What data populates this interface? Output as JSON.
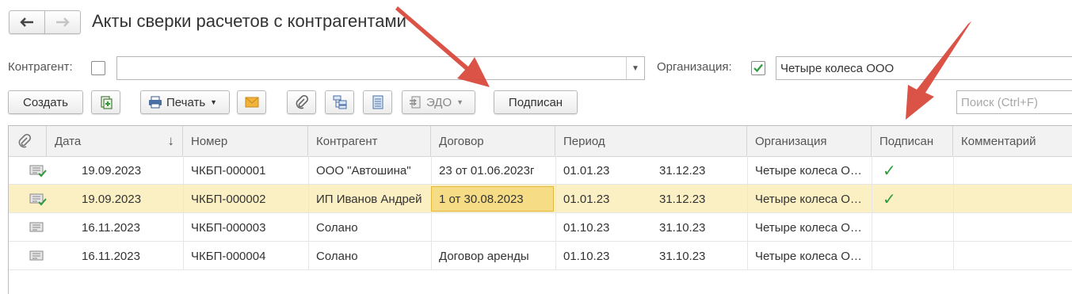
{
  "window": {
    "title": "Акты сверки расчетов с контрагентами"
  },
  "nav": {
    "back": "back-arrow-icon",
    "forward": "forward-arrow-icon"
  },
  "filters": {
    "counterparty_label": "Контрагент:",
    "counterparty_checked": false,
    "counterparty_value": "",
    "organization_label": "Организация:",
    "organization_checked": true,
    "organization_value": "Четыре колеса ООО"
  },
  "toolbar": {
    "create_label": "Создать",
    "print_label": "Печать",
    "edo_label": "ЭДО",
    "signed_label": "Подписан",
    "search_placeholder": "Поиск (Ctrl+F)"
  },
  "table": {
    "columns": [
      "",
      "Дата",
      "Номер",
      "Контрагент",
      "Договор",
      "Период",
      "",
      "Организация",
      "Подписан",
      "Комментарий"
    ],
    "sort_indicator": "↓",
    "rows": [
      {
        "icon": "document-signed-icon",
        "date": "19.09.2023",
        "number": "ЧКБП-000001",
        "counterparty": "ООО \"Автошина\"",
        "contract": "23 от 01.06.2023г",
        "period_start": "01.01.23",
        "period_end": "31.12.23",
        "organization": "Четыре колеса ООО",
        "signed": "✓",
        "comment": ""
      },
      {
        "icon": "document-signed-icon",
        "date": "19.09.2023",
        "number": "ЧКБП-000002",
        "counterparty": "ИП Иванов Андрей",
        "contract": "1 от 30.08.2023",
        "period_start": "01.01.23",
        "period_end": "31.12.23",
        "organization": "Четыре колеса ООО",
        "signed": "✓",
        "comment": ""
      },
      {
        "icon": "document-icon",
        "date": "16.11.2023",
        "number": "ЧКБП-000003",
        "counterparty": "Солано",
        "contract": "",
        "period_start": "01.10.23",
        "period_end": "31.10.23",
        "organization": "Четыре колеса ООО",
        "signed": "",
        "comment": ""
      },
      {
        "icon": "document-icon",
        "date": "16.11.2023",
        "number": "ЧКБП-000004",
        "counterparty": "Солано",
        "contract": "Договор аренды",
        "period_start": "01.10.23",
        "period_end": "31.10.23",
        "organization": "Четыре колеса ООО",
        "signed": "",
        "comment": ""
      }
    ],
    "selected_row": 1
  },
  "colors": {
    "accent_arrow": "#d94a3d",
    "selected_row": "#fbf0c4",
    "checkmark": "#2e9a3c"
  }
}
